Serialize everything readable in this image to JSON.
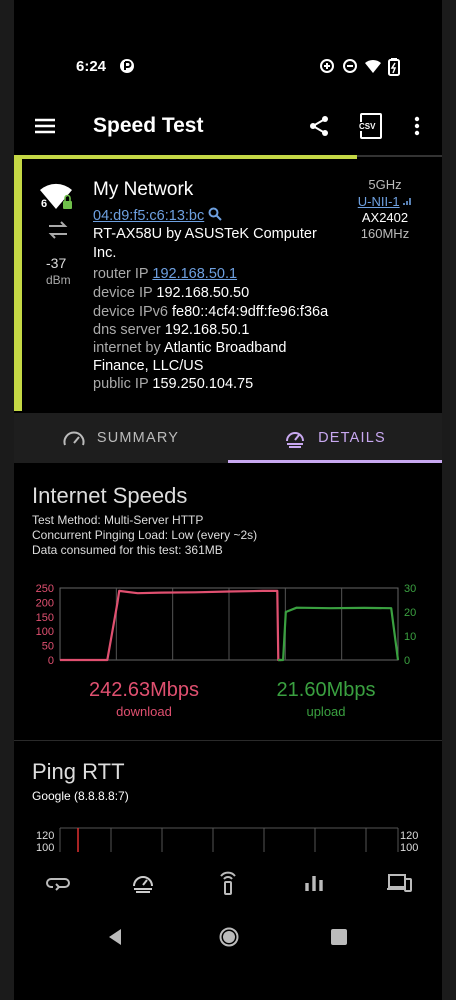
{
  "status_bar": {
    "time": "6:24"
  },
  "toolbar": {
    "title": "Speed Test",
    "csv_label": "CSV"
  },
  "network": {
    "name": "My Network",
    "wifi_generation": "6",
    "bssid": "04:d9:f5:c6:13:bc",
    "router_model_line1": "RT-AX58U by ASUSTeK Computer",
    "router_model_line2": "Inc.",
    "router_ip_label": "router IP",
    "router_ip": "192.168.50.1",
    "device_ip_label": "device IP",
    "device_ip": "192.168.50.50",
    "device_ipv6_label": "device IPv6",
    "device_ipv6": "fe80::4cf4:9dff:fe96:f36a",
    "dns_label": "dns server",
    "dns": "192.168.50.1",
    "internet_label": "internet by",
    "isp_line1": "Atlantic Broadband",
    "isp_line2": "Finance, LLC/US",
    "public_ip_label": "public IP",
    "public_ip": "159.250.104.75",
    "signal": "-37",
    "signal_unit": "dBm",
    "band": "5GHz",
    "channel": "U-NII-1",
    "standard": "AX2402",
    "width": "160MHz",
    "colors": {
      "accent": "#c5d845",
      "link": "#6ea0e0"
    }
  },
  "tabs": [
    {
      "label": "SUMMARY",
      "selected": false
    },
    {
      "label": "DETAILS",
      "selected": true
    }
  ],
  "internet_speeds": {
    "title": "Internet Speeds",
    "method": "Test Method: Multi-Server HTTP",
    "load": "Concurrent Pinging Load: Low (every ~2s)",
    "data_consumed": "Data consumed for this test: 361MB",
    "download_value": "242.63Mbps",
    "download_label": "download",
    "upload_value": "21.60Mbps",
    "upload_label": "upload"
  },
  "chart_data": {
    "type": "line",
    "left_axis": {
      "ticks": [
        "250",
        "200",
        "150",
        "100",
        "50",
        "0"
      ],
      "range": [
        0,
        250
      ],
      "color": "#e05070"
    },
    "right_axis": {
      "ticks": [
        "30",
        "20",
        "10",
        "0"
      ],
      "range": [
        0,
        30
      ],
      "color": "#3aa040"
    },
    "series": [
      {
        "name": "download",
        "color": "#e05070",
        "x": [
          0,
          0.14,
          0.17,
          0.175,
          0.23,
          0.3,
          0.4,
          0.5,
          0.6,
          0.643,
          0.646,
          0.655
        ],
        "y": [
          0,
          0,
          200,
          240,
          232,
          234,
          235,
          238,
          240,
          240,
          0,
          0
        ]
      },
      {
        "name": "upload",
        "color": "#3aa040",
        "x": [
          0.645,
          0.66,
          0.668,
          0.7,
          0.8,
          0.9,
          0.98,
          1.0
        ],
        "y": [
          0,
          0,
          20,
          21.8,
          21.6,
          21.7,
          21.6,
          0
        ]
      }
    ]
  },
  "ping": {
    "title": "Ping RTT",
    "target": "Google (8.8.8.8:7)",
    "left_ticks": [
      "120",
      "100"
    ],
    "right_ticks": [
      "120",
      "100"
    ]
  }
}
